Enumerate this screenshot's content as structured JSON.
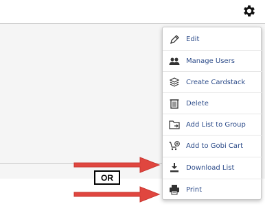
{
  "menu": {
    "items": [
      {
        "label": "Edit",
        "icon": "pencil-icon"
      },
      {
        "label": "Manage Users",
        "icon": "users-icon"
      },
      {
        "label": "Create Cardstack",
        "icon": "cardstack-icon"
      },
      {
        "label": "Delete",
        "icon": "trash-icon"
      },
      {
        "label": "Add List to Group",
        "icon": "folder-add-icon"
      },
      {
        "label": "Add to Gobi Cart",
        "icon": "cart-add-icon"
      },
      {
        "label": "Download List",
        "icon": "download-icon"
      },
      {
        "label": "Print",
        "icon": "printer-icon"
      }
    ]
  },
  "annotation": {
    "or_label": "OR",
    "arrow_color": "#e0463f"
  }
}
